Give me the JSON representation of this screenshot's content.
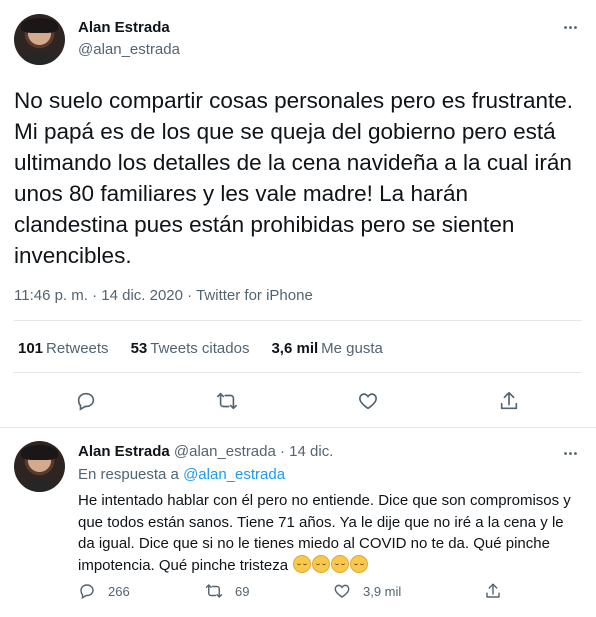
{
  "tweet": {
    "author_name": "Alan Estrada",
    "author_handle": "@alan_estrada",
    "text": "No suelo compartir cosas personales pero es frustrante. Mi papá es de los que se queja del gobierno pero está ultimando los detalles de la cena navideña a la cual irán unos 80 familiares y les vale madre! La harán clandestina pues están prohibidas pero se sienten invencibles.",
    "timestamp": "11:46 p. m. · 14 dic. 2020 · ",
    "source": "Twitter for iPhone",
    "stats": {
      "retweets_count": "101",
      "retweets_label": "Retweets",
      "quotes_count": "53",
      "quotes_label": "Tweets citados",
      "likes_count": "3,6 mil",
      "likes_label": "Me gusta"
    },
    "icons": [
      "reply-icon",
      "retweet-icon",
      "like-icon",
      "share-icon",
      "more-icon"
    ]
  },
  "reply": {
    "author_name": "Alan Estrada",
    "author_handle": "@alan_estrada",
    "date": " · 14 dic.",
    "in_reply_label": "En respuesta a ",
    "in_reply_handle": "@alan_estrada",
    "text": "He intentado hablar con él pero no entiende. Dice que son compromisos y que todos están sanos. Tiene 71 años. Ya le dije que no iré a la cena y le da igual. Dice que si no le tienes miedo al COVID no te da. Qué pinche impotencia. Qué pinche tristeza ",
    "emoji_name": "pensive-face-emoji",
    "emoji_count": 4,
    "reply_count": "266",
    "retweet_count": "69",
    "like_count": "3,9 mil"
  },
  "colors": {
    "text": "#0f1419",
    "secondary": "#536471",
    "link": "#1d9bf0",
    "divider": "#e4e8ea"
  }
}
